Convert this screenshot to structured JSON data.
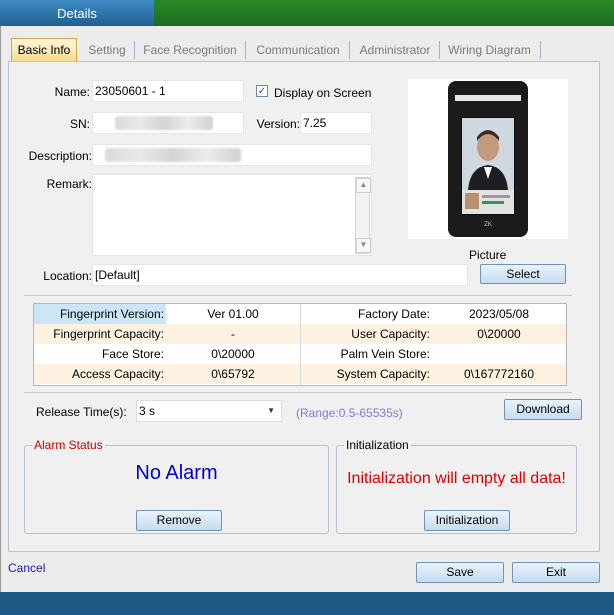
{
  "window": {
    "title": "Details"
  },
  "tabs": [
    {
      "label": "Basic Info",
      "active": true
    },
    {
      "label": "Setting"
    },
    {
      "label": "Face Recognition"
    },
    {
      "label": "Communication"
    },
    {
      "label": "Administrator"
    },
    {
      "label": "Wiring Diagram"
    }
  ],
  "basic": {
    "name_label": "Name:",
    "name_value": "23050601 - 1",
    "display_on_screen_label": "Display on Screen",
    "display_on_screen_checked": true,
    "display_on_screen_mark": "✓",
    "sn_label": "SN:",
    "version_label": "Version:",
    "version_value": "7.25",
    "description_label": "Description:",
    "remark_label": "Remark:",
    "remark_value": "",
    "location_label": "Location:",
    "location_value": "[Default]",
    "picture_label": "Picture",
    "select_button": "Select"
  },
  "info_table": {
    "rows": [
      {
        "l1": "Fingerprint Version:",
        "v1": "Ver 01.00",
        "l2": "Factory Date:",
        "v2": "2023/05/08"
      },
      {
        "l1": "Fingerprint Capacity:",
        "v1": "-",
        "l2": "User Capacity:",
        "v2": "0\\20000"
      },
      {
        "l1": "Face Store:",
        "v1": "0\\20000",
        "l2": "Palm Vein Store:",
        "v2": ""
      },
      {
        "l1": "Access Capacity:",
        "v1": "0\\65792",
        "l2": "System Capacity:",
        "v2": "0\\167772160"
      }
    ]
  },
  "release": {
    "label": "Release Time(s):",
    "value": "3 s",
    "range": "(Range:0.5-65535s)",
    "download_button": "Download"
  },
  "alarm": {
    "legend": "Alarm Status",
    "status": "No Alarm",
    "remove_button": "Remove"
  },
  "init": {
    "legend": "Initialization",
    "warning": "Initialization will empty all data!",
    "button": "Initialization"
  },
  "footer": {
    "cancel_link": "Cancel",
    "save_button": "Save",
    "exit_button": "Exit"
  },
  "colors": {
    "accent_blue": "#1e5a85",
    "title_green": "#1d6b1d",
    "alarm_ok": "#0000cc",
    "warning_red": "#e00000",
    "legend_red": "#d00000",
    "range_text": "#7b7be0",
    "row_highlight": "#cde6f7",
    "row_alt": "#fdf2e2"
  },
  "icons": {
    "dropdown": "chevron-down-icon",
    "scroll_up": "scroll-up-icon",
    "scroll_down": "scroll-down-icon",
    "checkbox": "checkbox-icon"
  }
}
